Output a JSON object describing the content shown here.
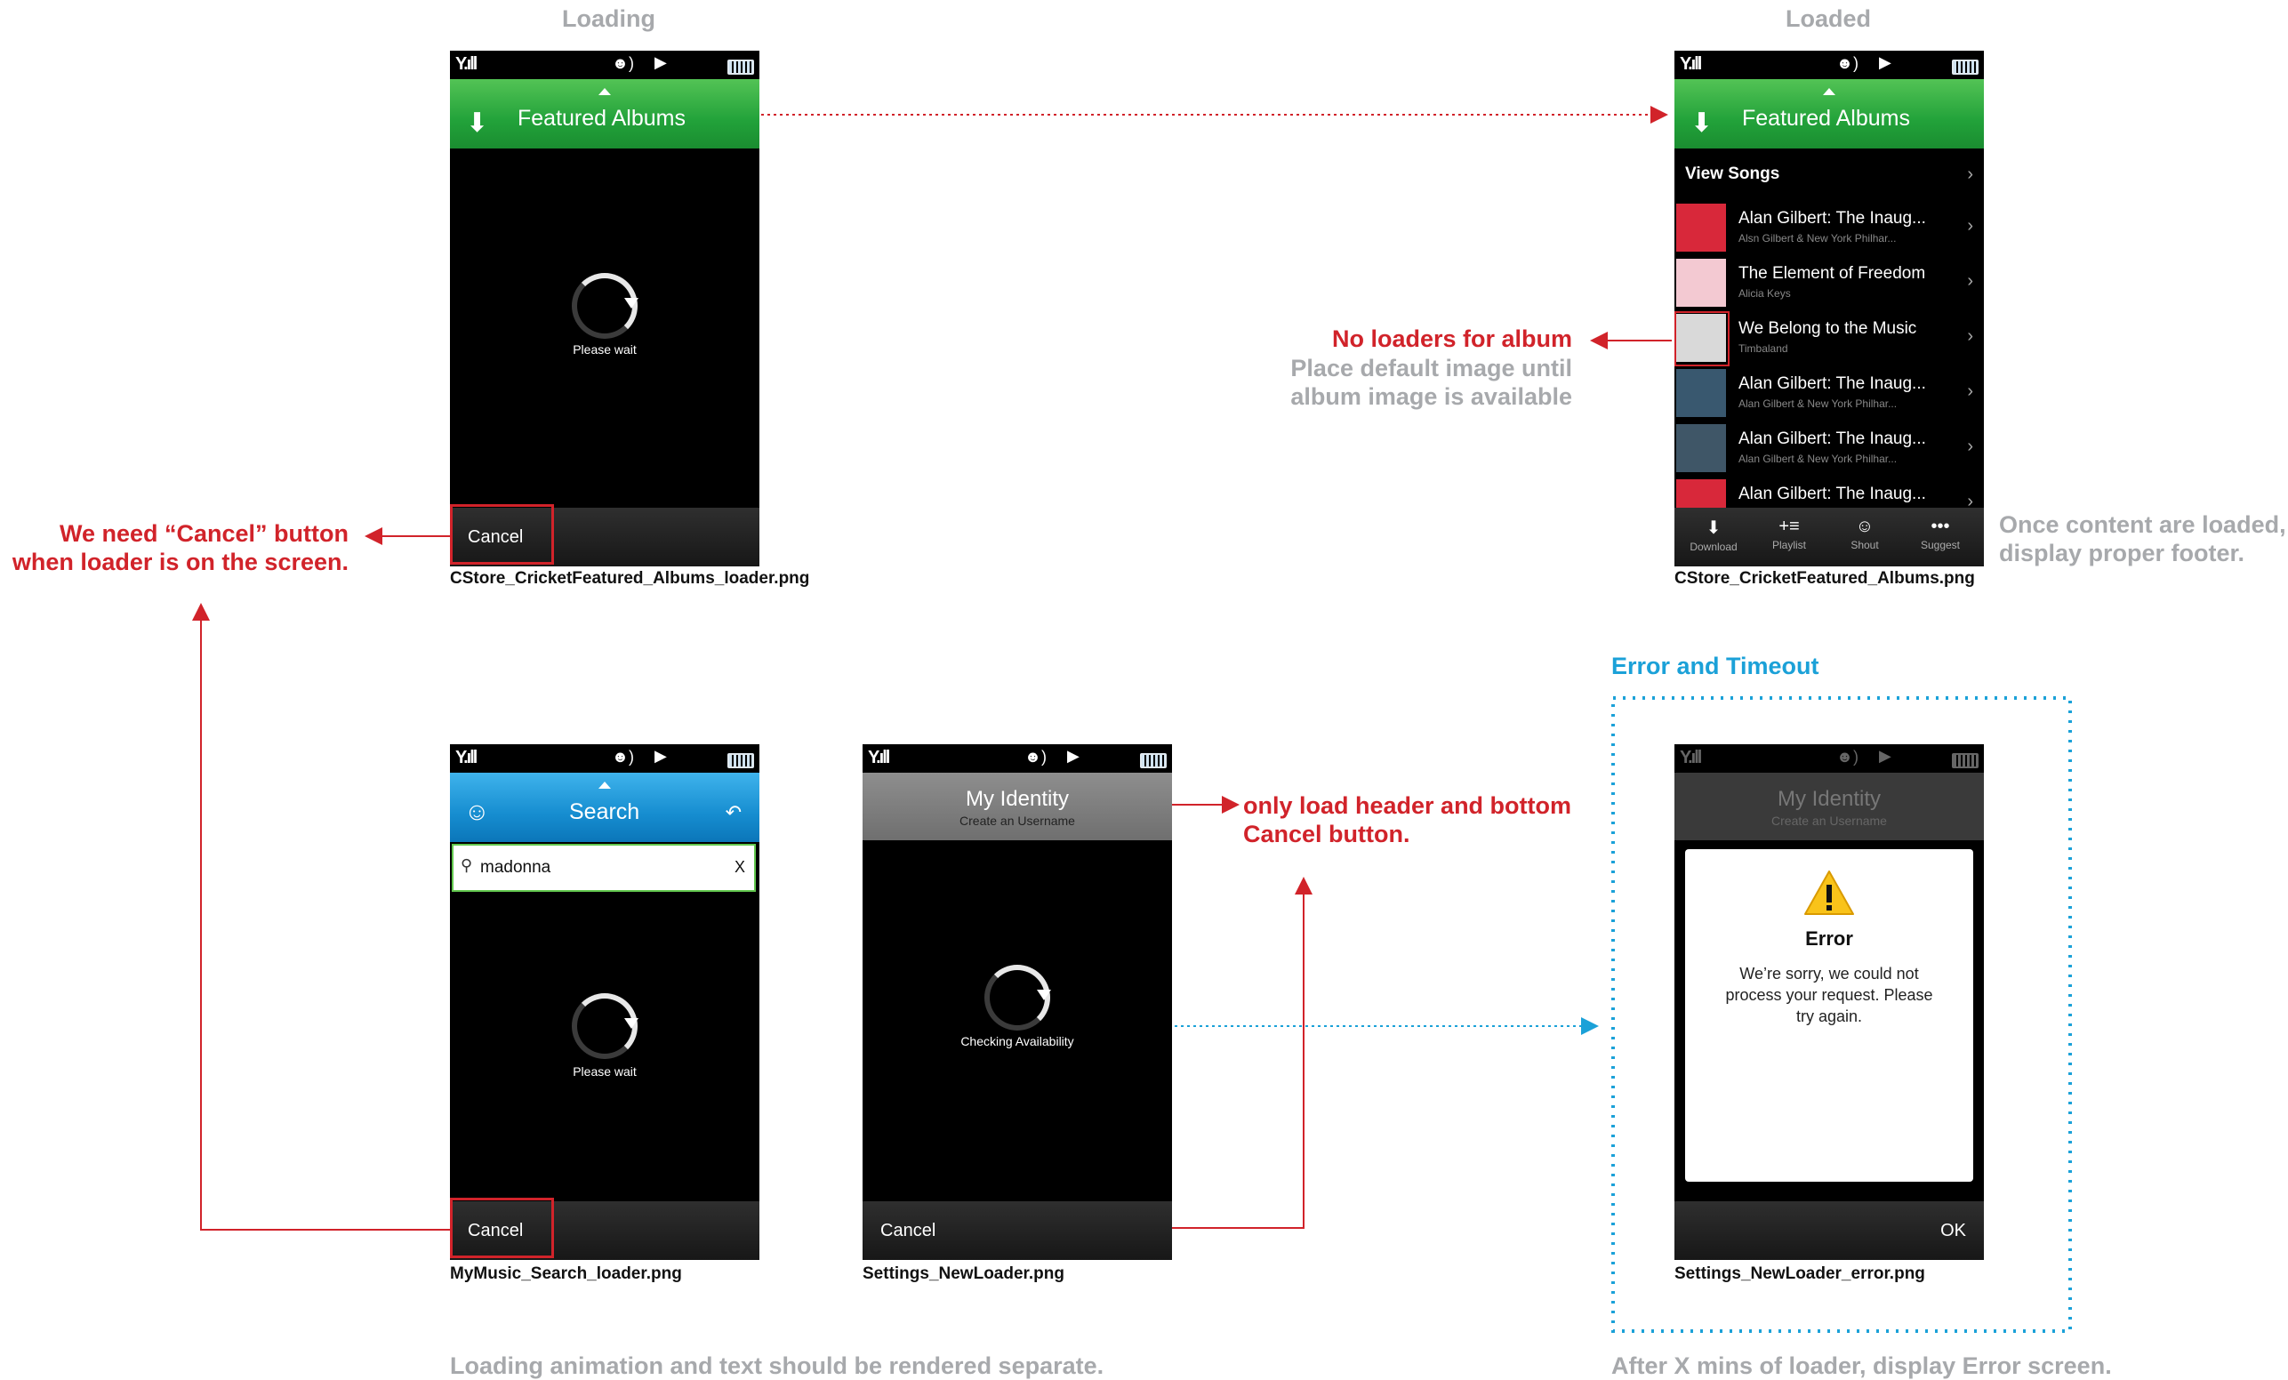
{
  "headings": {
    "loading": "Loading",
    "loaded": "Loaded"
  },
  "notes": {
    "cancel_needed": "We need “Cancel” button\nwhen loader is on the screen.",
    "no_loaders": "No loaders for album",
    "default_image": "Place default image until\nalbum image is available",
    "proper_footer": "Once content are loaded,\ndisplay proper footer.",
    "header_cancel": "only load header and bottom\nCancel button.",
    "error_timeout": "Error and Timeout",
    "render_separate": "Loading animation and text should be rendered separate.",
    "after_x_mins": "After X mins of loader, display Error screen."
  },
  "captions": {
    "featured_loader": "CStore_CricketFeatured_Albums_loader.png",
    "featured": "CStore_CricketFeatured_Albums.png",
    "search_loader": "MyMusic_Search_loader.png",
    "settings_loader": "Settings_NewLoader.png",
    "settings_error": "Settings_NewLoader_error.png"
  },
  "screen_featured_loader": {
    "title": "Featured Albums",
    "wait": "Please wait",
    "cancel": "Cancel"
  },
  "screen_featured": {
    "title": "Featured Albums",
    "view_songs": "View Songs",
    "albums": [
      {
        "title": "Alan Gilbert: The Inaug...",
        "artist": "Alsn Gilbert & New York Philhar...",
        "color": "#d8283a"
      },
      {
        "title": "The Element of Freedom",
        "artist": "Alicia Keys",
        "color": "#f3c9d2"
      },
      {
        "title": "We Belong to the Music",
        "artist": "Timbaland",
        "color": "#d9d9d9"
      },
      {
        "title": "Alan Gilbert: The Inaug...",
        "artist": "Alan Gilbert & New York Philhar...",
        "color": "#39586f"
      },
      {
        "title": "Alan Gilbert: The Inaug...",
        "artist": "Alan Gilbert & New York Philhar...",
        "color": "#3f5667"
      },
      {
        "title": "Alan Gilbert: The Inaug...",
        "artist": "",
        "color": "#d8283a"
      }
    ],
    "toolbar": [
      {
        "icon": "⬇",
        "label": "Download"
      },
      {
        "icon": "+≡",
        "label": "Playlist"
      },
      {
        "icon": "☺",
        "label": "Shout"
      },
      {
        "icon": "•••",
        "label": "Suggest"
      }
    ]
  },
  "screen_search_loader": {
    "title": "Search",
    "query": "madonna",
    "clear": "X",
    "wait": "Please wait",
    "cancel": "Cancel"
  },
  "screen_settings_loader": {
    "title": "My Identity",
    "subtitle": "Create an Username",
    "wait": "Checking Availability",
    "cancel": "Cancel"
  },
  "screen_settings_error": {
    "title": "My Identity",
    "subtitle": "Create an Username",
    "error_title": "Error",
    "error_msg": "We’re sorry, we could not\nprocess your request. Please\ntry again.",
    "ok": "OK"
  },
  "colors": {
    "red": "#d1232a",
    "gray": "#a7a9ac",
    "blue": "#1ba1d8",
    "green": "#22a23a"
  }
}
